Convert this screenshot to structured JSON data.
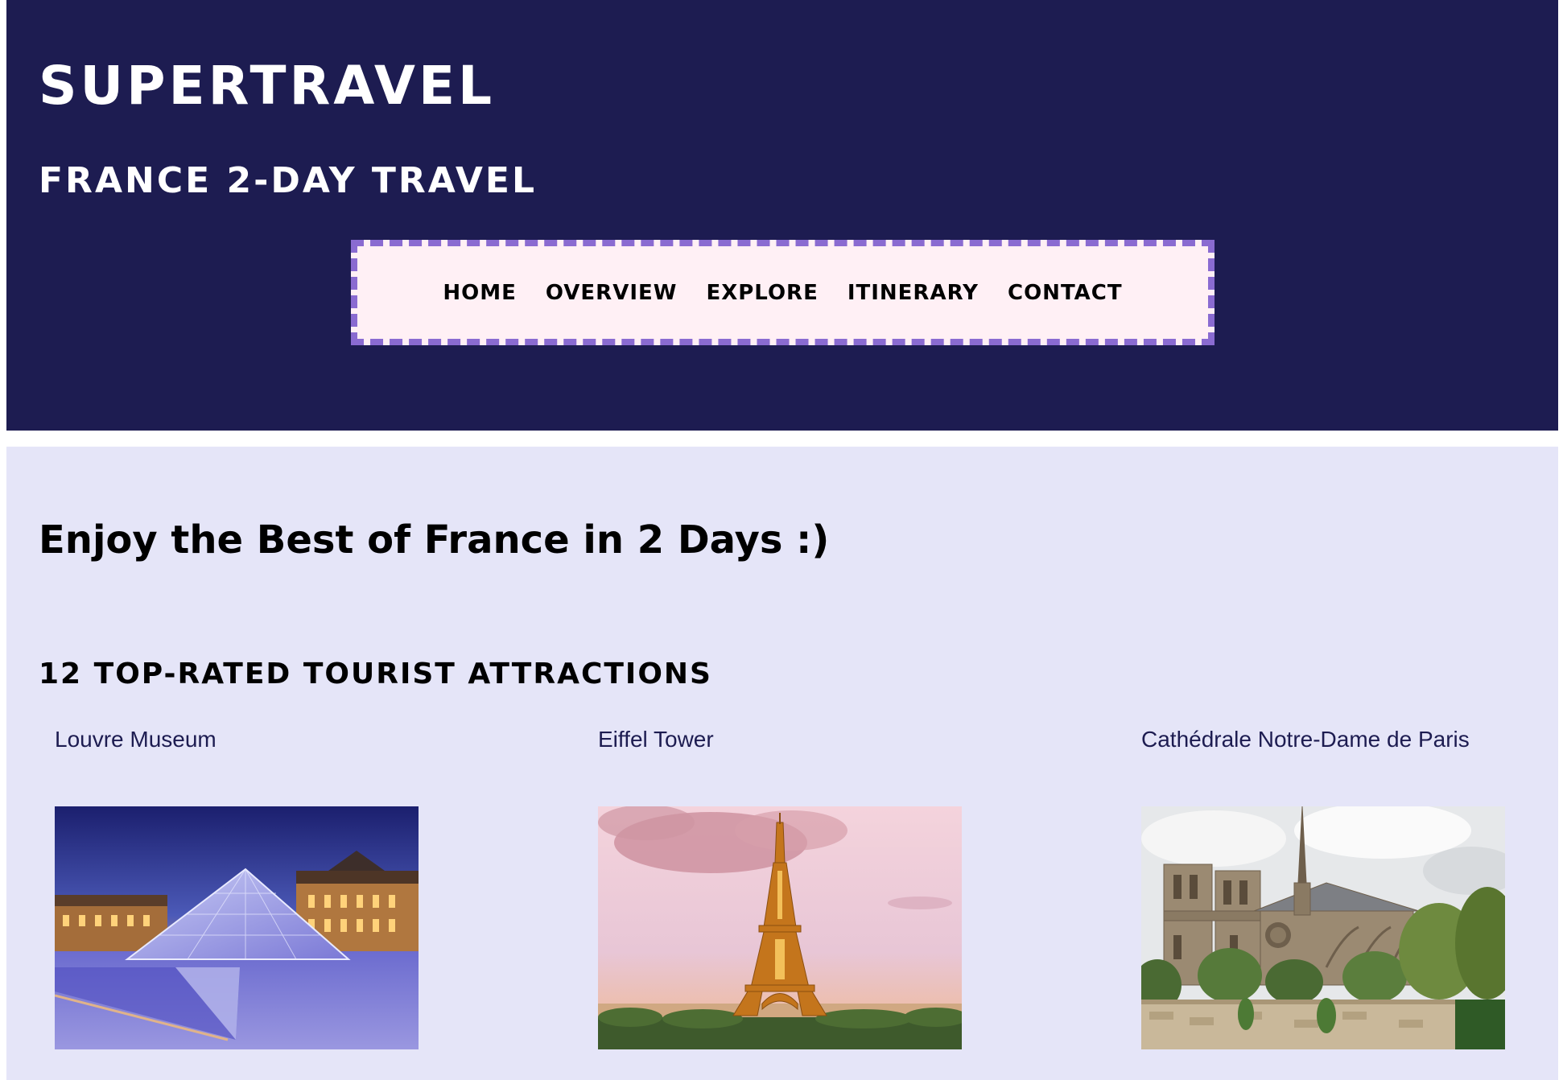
{
  "header": {
    "site_title": "SUPERTRAVEL",
    "subtitle": "FRANCE 2-DAY TRAVEL",
    "nav": [
      {
        "label": "HOME"
      },
      {
        "label": "OVERVIEW"
      },
      {
        "label": "EXPLORE"
      },
      {
        "label": "ITINERARY"
      },
      {
        "label": "CONTACT"
      }
    ]
  },
  "main": {
    "tagline": "Enjoy the Best of France in 2 Days :)",
    "section_heading": "12 TOP-RATED TOURIST ATTRACTIONS",
    "attractions": [
      {
        "name": "Louvre Museum",
        "image": "louvre-pyramid-photo"
      },
      {
        "name": "Eiffel Tower",
        "image": "eiffel-tower-photo"
      },
      {
        "name": "Cathédrale Notre-Dame de Paris",
        "image": "notre-dame-cathedral-photo"
      }
    ]
  },
  "colors": {
    "header_bg": "#1d1c51",
    "nav_bg": "#fff0f5",
    "nav_border": "#8a6bd1",
    "content_bg": "#e5e5f8",
    "attraction_title": "#1d1c51"
  }
}
